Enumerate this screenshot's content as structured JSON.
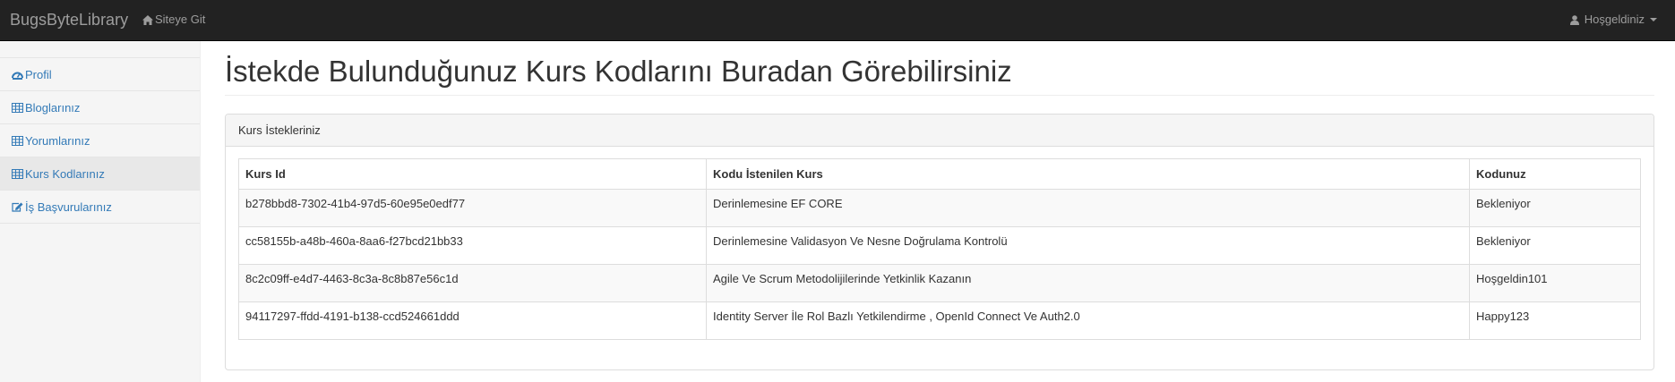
{
  "navbar": {
    "brand": "BugsByteLibrary",
    "site_link": "Siteye Git",
    "site_link_icon": "home-icon",
    "user_label": "Hoşgeldiniz",
    "user_icon": "user-icon"
  },
  "sidebar": {
    "items": [
      {
        "label": "Profil",
        "icon": "dashboard-icon"
      },
      {
        "label": "Bloglarınız",
        "icon": "table-icon"
      },
      {
        "label": "Yorumlarınız",
        "icon": "table-icon"
      },
      {
        "label": "Kurs Kodlarınız",
        "icon": "table-icon",
        "active": true
      },
      {
        "label": "İş Başvurularınız",
        "icon": "edit-icon"
      }
    ]
  },
  "main": {
    "title": "İstekde Bulunduğunuz Kurs Kodlarını Buradan Görebilirsiniz",
    "panel_heading": "Kurs İstekleriniz",
    "table": {
      "headers": [
        "Kurs Id",
        "Kodu İstenilen Kurs",
        "Kodunuz"
      ],
      "rows": [
        [
          "b278bbd8-7302-41b4-97d5-60e95e0edf77",
          "Derinlemesine EF CORE",
          "Bekleniyor"
        ],
        [
          "cc58155b-a48b-460a-8aa6-f27bcd21bb33",
          "Derinlemesine Validasyon Ve Nesne Doğrulama Kontrolü",
          "Bekleniyor"
        ],
        [
          "8c2c09ff-e4d7-4463-8c3a-8c8b87e56c1d",
          "Agile Ve Scrum Metodolijilerinde Yetkinlik Kazanın",
          "Hoşgeldin101"
        ],
        [
          "94117297-ffdd-4191-b138-ccd524661ddd",
          "Identity Server İle Rol Bazlı Yetkilendirme , OpenId Connect Ve Auth2.0",
          "Happy123"
        ]
      ]
    }
  },
  "colors": {
    "navbar_bg": "#222222",
    "navbar_text": "#9d9d9d",
    "link": "#337ab7",
    "sidebar_bg": "#f5f5f5"
  }
}
